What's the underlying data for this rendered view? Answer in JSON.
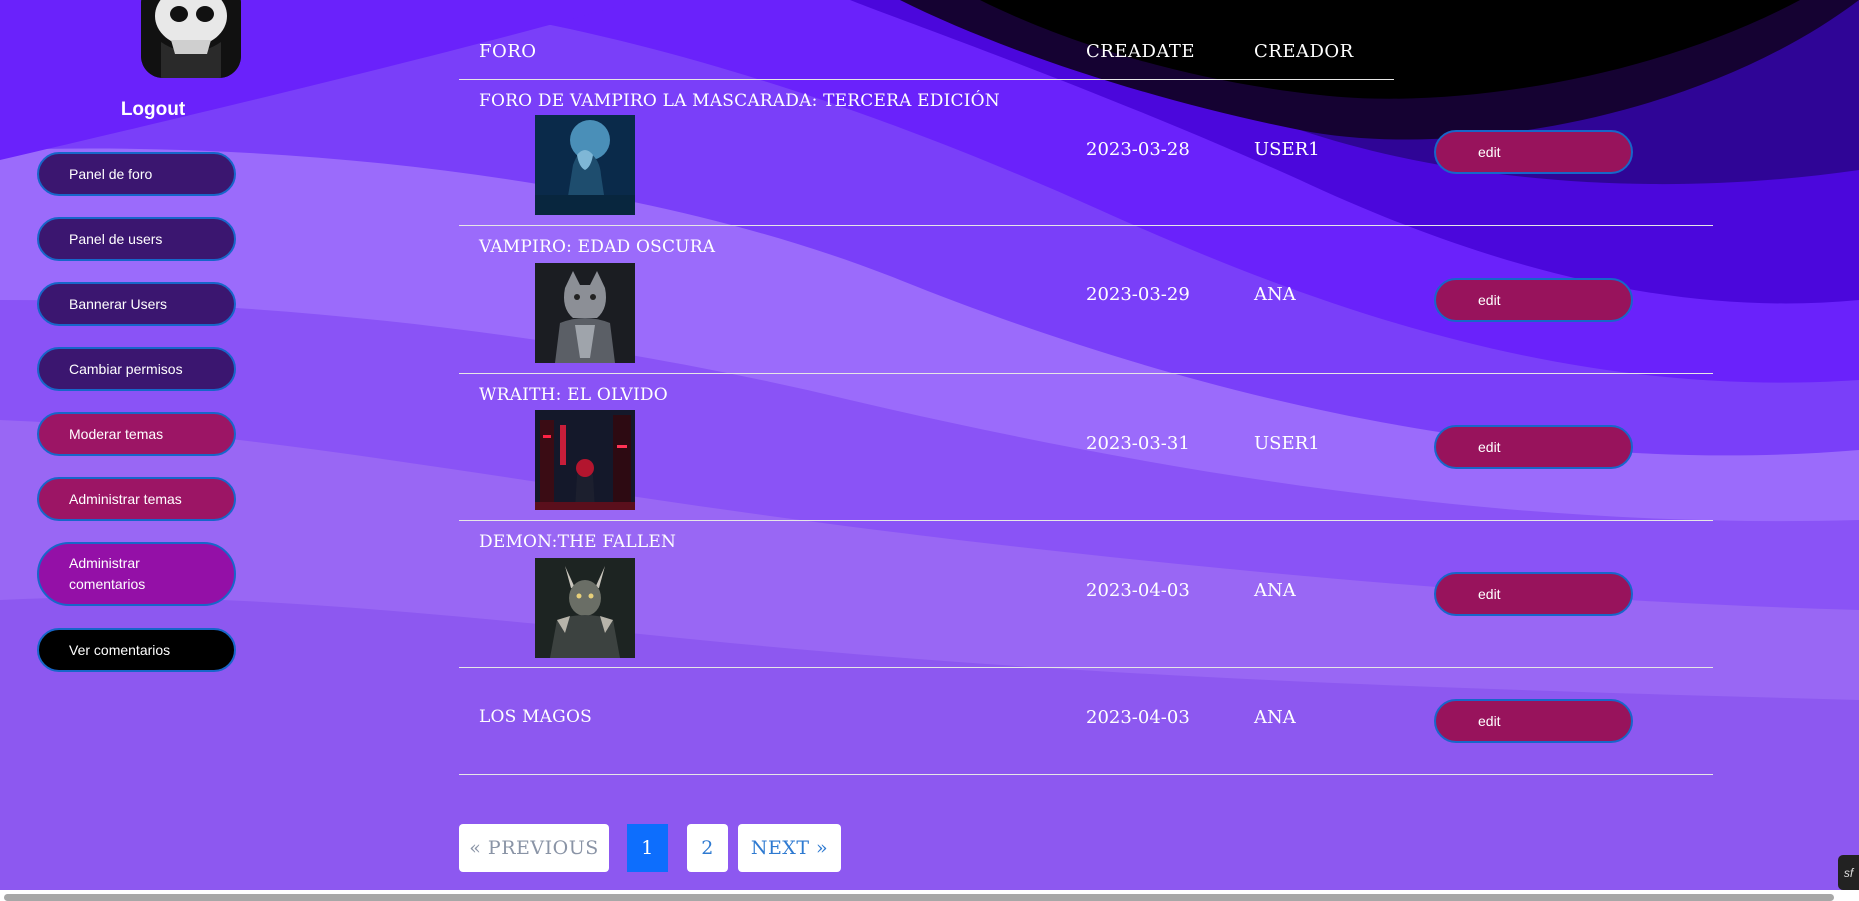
{
  "sidebar": {
    "logout": "Logout",
    "items": [
      {
        "label": "Panel de foro"
      },
      {
        "label": "Panel de users"
      },
      {
        "label": "Bannerar Users"
      },
      {
        "label": "Cambiar permisos"
      },
      {
        "label": "Moderar temas"
      },
      {
        "label": "Administrar temas"
      },
      {
        "label": "Administrar comentarios"
      },
      {
        "label": "Ver comentarios"
      }
    ]
  },
  "table": {
    "headers": {
      "foro": "FORO",
      "createdate": "CREADATE",
      "creador": "CREADOR"
    },
    "rows": [
      {
        "foro": "FORO DE VAMPIRO LA MASCARADA: TERCERA EDICIÓN",
        "createdate": "2023-03-28",
        "creador": "USER1",
        "action": "edit",
        "image": "blue-werewolf-thumbnail"
      },
      {
        "foro": "VAMPIRO: EDAD OSCURA",
        "createdate": "2023-03-29",
        "creador": "ANA",
        "action": "edit",
        "image": "armored-cat-warrior-thumbnail"
      },
      {
        "foro": "WRAITH: EL OLVIDO",
        "createdate": "2023-03-31",
        "creador": "USER1",
        "action": "edit",
        "image": "red-hood-city-thumbnail"
      },
      {
        "foro": "DEMON:THE FALLEN",
        "createdate": "2023-04-03",
        "creador": "ANA",
        "action": "edit",
        "image": "horned-demon-thumbnail"
      },
      {
        "foro": "LOS MAGOS",
        "createdate": "2023-04-03",
        "creador": "ANA",
        "action": "edit",
        "image": ""
      }
    ]
  },
  "pagination": {
    "previous": "« PREVIOUS",
    "pages": [
      "1",
      "2"
    ],
    "current": "1",
    "next": "NEXT »"
  },
  "colors": {
    "edit_button": "#98135c",
    "nav_dark": "#3b1670",
    "nav_rose": "#9c1565",
    "nav_magenta": "#9410a7",
    "active_page": "#0d6efd"
  }
}
